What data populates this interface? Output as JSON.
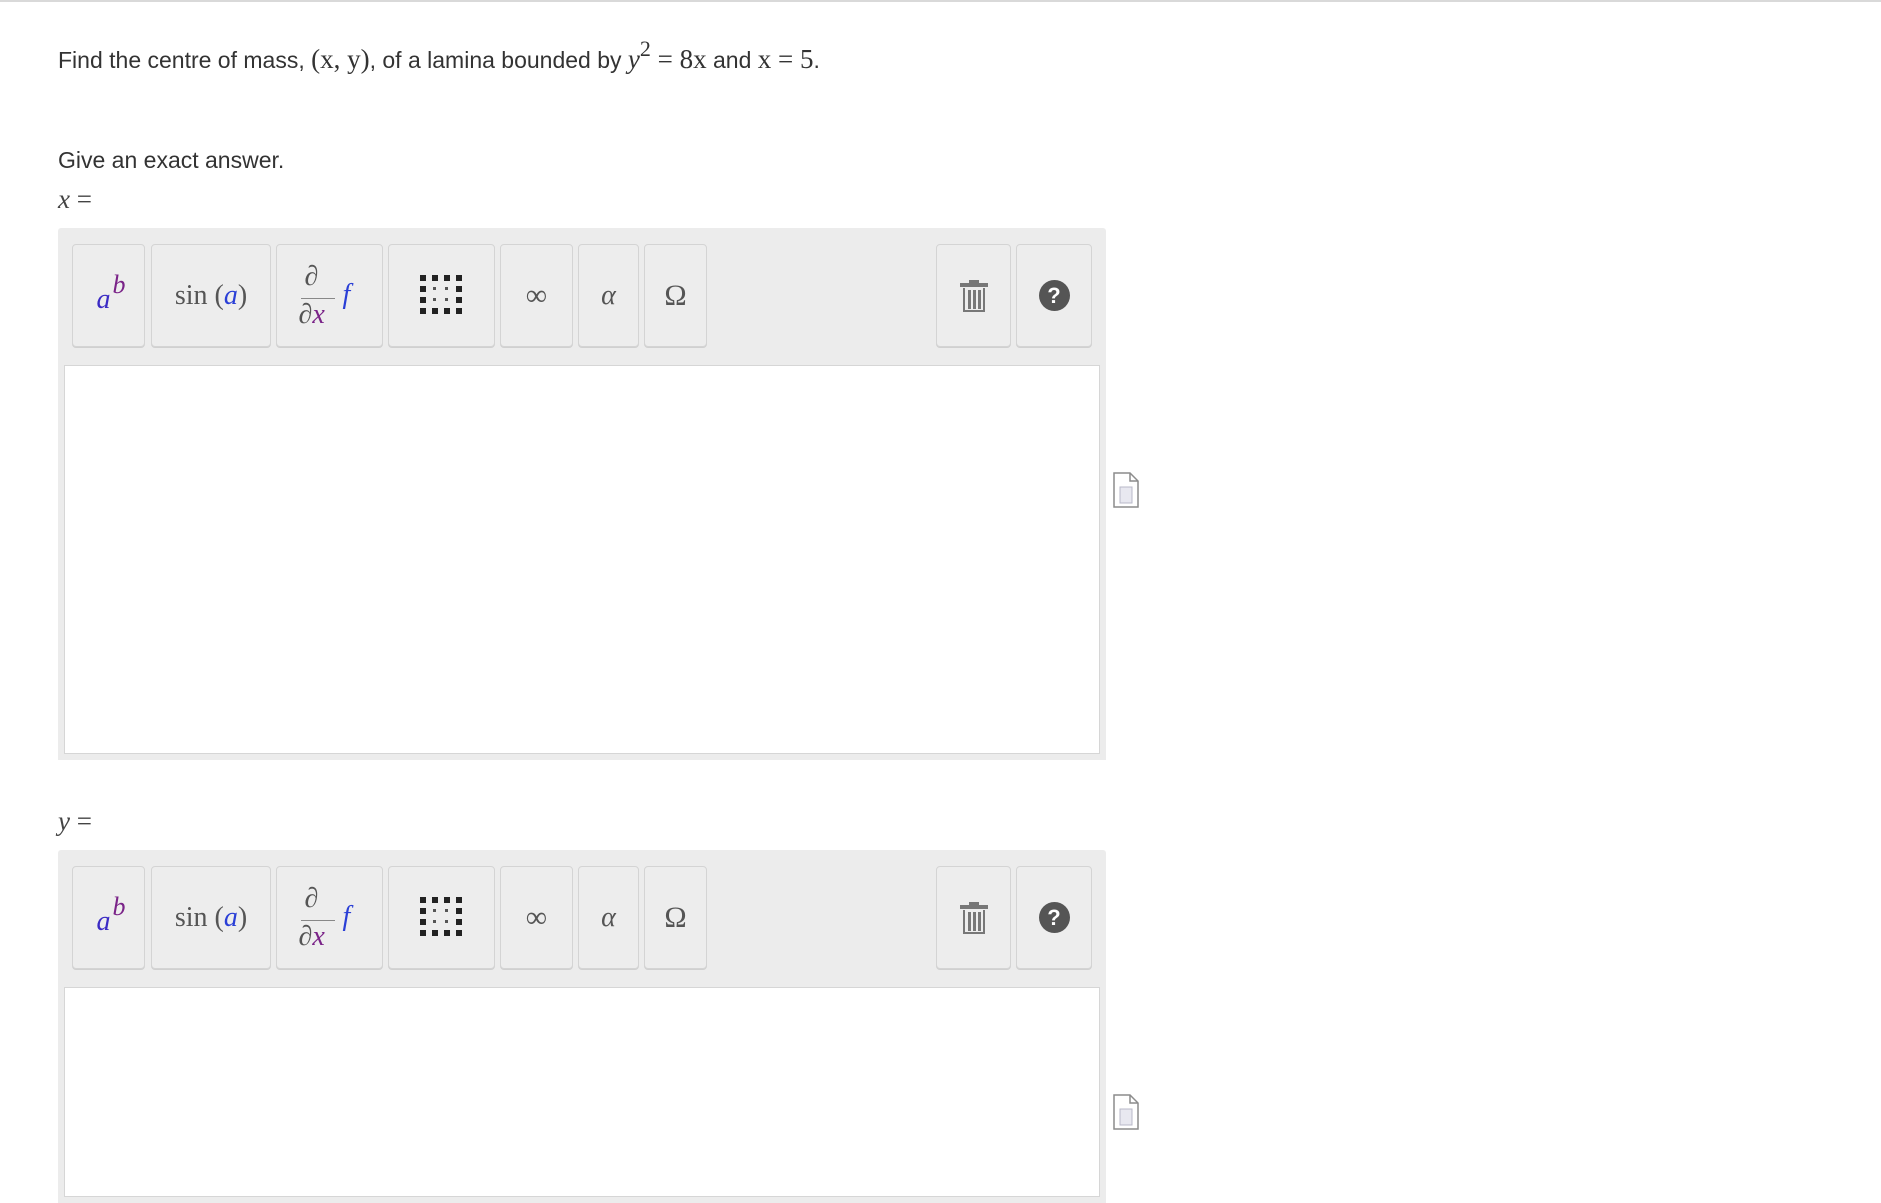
{
  "question": {
    "prefix": "Find the centre of mass,",
    "point": "(x, y)",
    "middle": ", of a lamina bounded by",
    "curve_base": "y",
    "curve_exp": "2",
    "curve_rhs": "= 8x",
    "connector": "and",
    "line": "x = 5",
    "end": "."
  },
  "instruction": "Give an exact answer.",
  "answers": [
    {
      "var": "x",
      "eq": "="
    },
    {
      "var": "y",
      "eq": "="
    }
  ],
  "toolbar": {
    "power": {
      "base": "a",
      "exp": "b"
    },
    "function": {
      "name": "sin",
      "arg": "a"
    },
    "derivative": {
      "num": "∂",
      "den_sym": "∂",
      "den_var": "x",
      "func": "f"
    },
    "infinity": "∞",
    "alpha": "α",
    "omega": "Ω",
    "help": "?"
  },
  "icons": {
    "power": "power-icon",
    "function": "sine-function-icon",
    "derivative": "partial-derivative-icon",
    "matrix": "matrix-icon",
    "infinity": "infinity-icon",
    "alpha": "greek-letters-icon",
    "omega": "symbols-icon",
    "trash": "trash-icon",
    "help": "help-icon",
    "preview": "document-preview-icon"
  },
  "colors": {
    "accent_blue": "#2a3fd6",
    "accent_purple": "#7a2388",
    "toolbar_bg": "#ececec"
  }
}
